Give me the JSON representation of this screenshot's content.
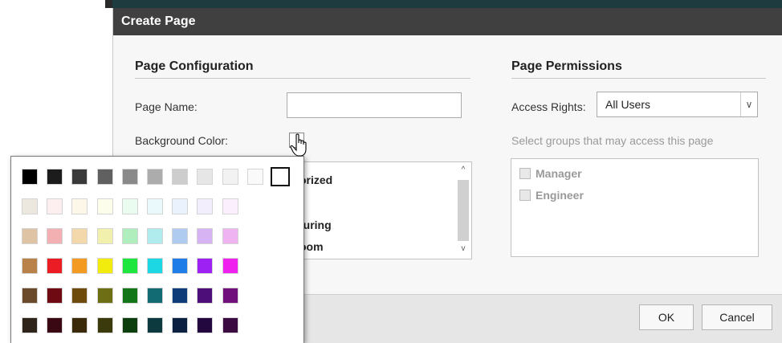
{
  "dialog": {
    "title": "Create Page"
  },
  "config": {
    "section_title": "Page Configuration",
    "page_name_label": "Page Name:",
    "page_name_value": "",
    "background_color_label": "Background Color:"
  },
  "permissions": {
    "section_title": "Page Permissions",
    "access_rights_label": "Access Rights:",
    "access_rights_value": "All Users",
    "groups_hint": "Select groups that may access this page",
    "groups": [
      {
        "label": "Manager"
      },
      {
        "label": "Engineer"
      }
    ]
  },
  "category_list": {
    "items": [
      "orized",
      "turing",
      "oom"
    ]
  },
  "buttons": {
    "ok": "OK",
    "cancel": "Cancel"
  },
  "palette": {
    "rows": [
      [
        "#000000",
        "#1c1c1c",
        "#3a3a3a",
        "#606060",
        "#8a8a8a",
        "#acacac",
        "#cdcdcd",
        "#e6e6e6",
        "#f2f2f2",
        "#fafafa",
        "#ffffff"
      ],
      [
        "#ece8e0",
        "#fdeef0",
        "#fdf7ea",
        "#fcfdea",
        "#eafcef",
        "#eafafc",
        "#eaf2fd",
        "#f3eefd",
        "#fbeefd"
      ],
      [
        "#dec3a4",
        "#f2b0b2",
        "#f3d8ac",
        "#f1f0ac",
        "#b0eebd",
        "#b0ecee",
        "#b0cbf0",
        "#d6b3f2",
        "#f0b3f2"
      ],
      [
        "#b9824a",
        "#ec1c24",
        "#f29a22",
        "#f2ec0e",
        "#1de73e",
        "#1dd8e2",
        "#1f7de8",
        "#9d21f2",
        "#ee21ee"
      ],
      [
        "#6b4a2b",
        "#6e0a12",
        "#6e4a0d",
        "#6e6e14",
        "#127518",
        "#126b73",
        "#0e3c78",
        "#4e0e7a",
        "#70107a"
      ],
      [
        "#2e241a",
        "#3a0812",
        "#3a2a0a",
        "#3a3a0c",
        "#0c3e0e",
        "#0c3a3e",
        "#0c2042",
        "#22083e",
        "#3a0a40"
      ]
    ],
    "selected": "#ffffff"
  }
}
